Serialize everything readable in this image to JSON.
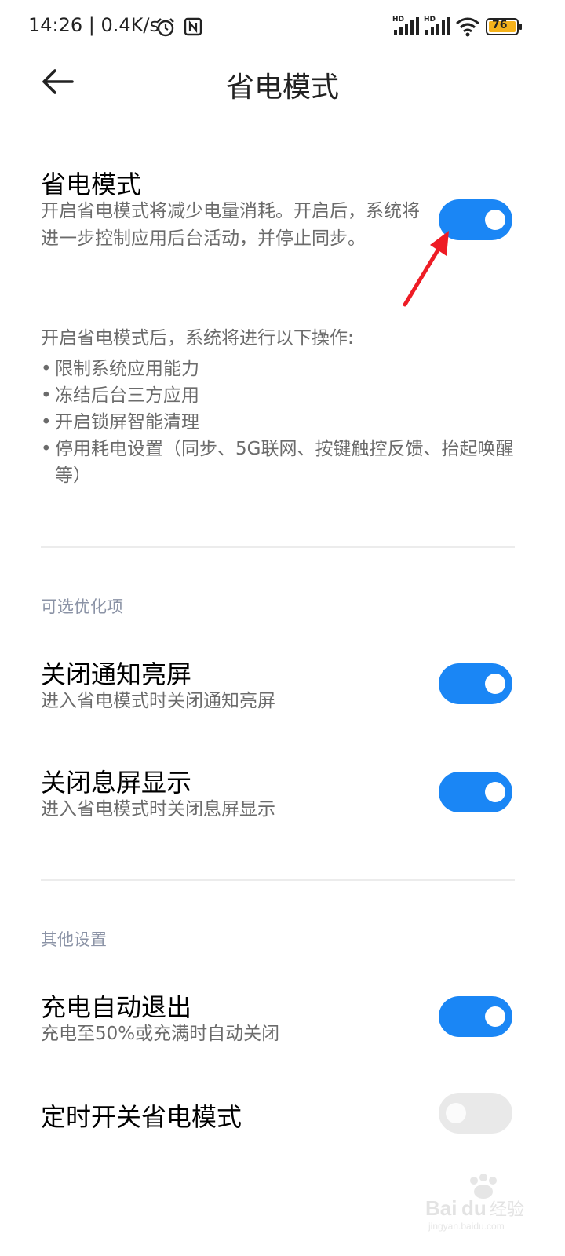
{
  "status_bar": {
    "time_and_speed": "14:26 | 0.4K/s",
    "hd_label": "HD",
    "battery_level": "76"
  },
  "header": {
    "title": "省电模式"
  },
  "main_setting": {
    "title": "省电模式",
    "description": "开启省电模式将减少电量消耗。开启后，系统将进一步控制应用后台活动，并停止同步。",
    "enabled": true
  },
  "info": {
    "intro": "开启省电模式后，系统将进行以下操作:",
    "bullet": "•",
    "items": [
      "限制系统应用能力",
      "冻结后台三方应用",
      "开启锁屏智能清理",
      "停用耗电设置（同步、5G联网、按键触控反馈、抬起唤醒等）"
    ]
  },
  "optional_section": {
    "label": "可选优化项",
    "items": [
      {
        "title": "关闭通知亮屏",
        "description": "进入省电模式时关闭通知亮屏",
        "enabled": true
      },
      {
        "title": "关闭息屏显示",
        "description": "进入省电模式时关闭息屏显示",
        "enabled": true
      }
    ]
  },
  "other_section": {
    "label": "其他设置",
    "items": [
      {
        "title": "充电自动退出",
        "description": "充电至50%或充满时自动关闭",
        "enabled": true
      },
      {
        "title": "定时开关省电模式",
        "enabled": false
      }
    ]
  },
  "watermark": {
    "brand": "Baidu经验",
    "url": "jingyan.baidu.com"
  },
  "colors": {
    "toggle_on": "#1a86f5",
    "toggle_off": "#e9e9e9",
    "annotation_arrow": "#ee1c25"
  }
}
